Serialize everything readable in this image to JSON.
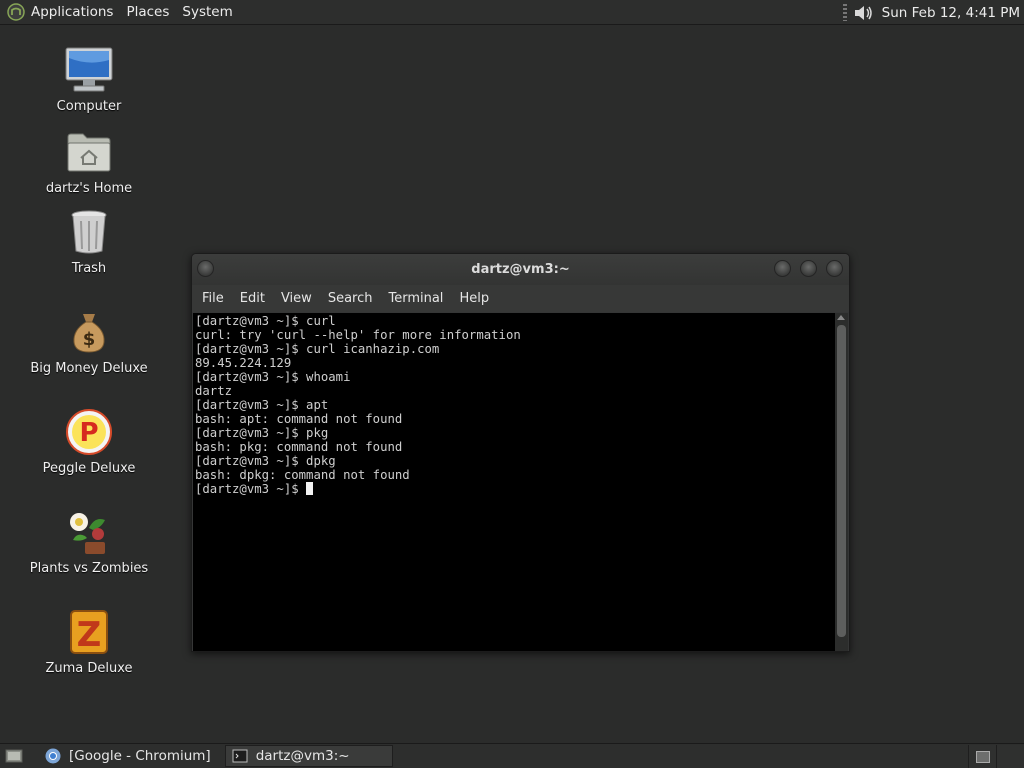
{
  "top_panel": {
    "menus": [
      "Applications",
      "Places",
      "System"
    ],
    "clock": "Sun Feb 12,  4:41 PM"
  },
  "desktop_icons": [
    {
      "label": "Computer",
      "icon": "computer-icon"
    },
    {
      "label": "dartz's Home",
      "icon": "home-folder-icon"
    },
    {
      "label": "Trash",
      "icon": "trash-icon"
    },
    {
      "label": "Big Money Deluxe",
      "icon": "money-bag-icon"
    },
    {
      "label": "Peggle Deluxe",
      "icon": "peggle-icon"
    },
    {
      "label": "Plants vs Zombies",
      "icon": "plants-vs-zombies-icon"
    },
    {
      "label": "Zuma Deluxe",
      "icon": "zuma-icon"
    }
  ],
  "terminal": {
    "title": "dartz@vm3:~",
    "menu": [
      "File",
      "Edit",
      "View",
      "Search",
      "Terminal",
      "Help"
    ],
    "lines": [
      "[dartz@vm3 ~]$ curl",
      "curl: try 'curl --help' for more information",
      "[dartz@vm3 ~]$ curl icanhazip.com",
      "89.45.224.129",
      "[dartz@vm3 ~]$ whoami",
      "dartz",
      "[dartz@vm3 ~]$ apt",
      "bash: apt: command not found",
      "[dartz@vm3 ~]$ pkg",
      "bash: pkg: command not found",
      "[dartz@vm3 ~]$ dpkg",
      "bash: dpkg: command not found",
      "[dartz@vm3 ~]$"
    ]
  },
  "taskbar": {
    "tasks": [
      "[Google - Chromium]",
      "dartz@vm3:~"
    ]
  }
}
